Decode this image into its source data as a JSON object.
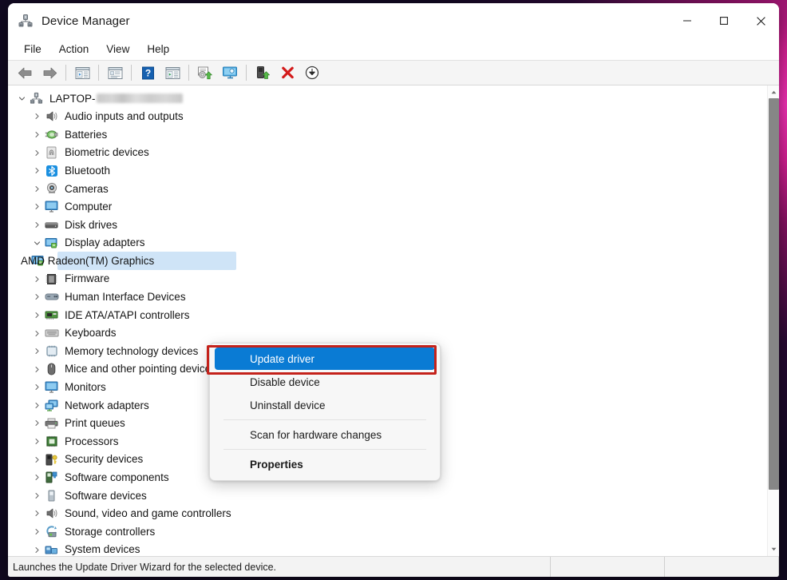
{
  "window": {
    "title": "Device Manager",
    "icon": "device-manager-icon",
    "controls": {
      "minimize": "minimize-icon",
      "maximize": "maximize-icon",
      "close": "close-icon"
    }
  },
  "menubar": {
    "items": [
      {
        "label": "File"
      },
      {
        "label": "Action"
      },
      {
        "label": "View"
      },
      {
        "label": "Help"
      }
    ]
  },
  "toolbar": {
    "buttons": [
      {
        "name": "back-icon"
      },
      {
        "name": "forward-icon"
      },
      {
        "name": "separator"
      },
      {
        "name": "show-hide-console-tree-icon"
      },
      {
        "name": "separator"
      },
      {
        "name": "properties-icon"
      },
      {
        "name": "separator"
      },
      {
        "name": "help-icon"
      },
      {
        "name": "show-details-icon"
      },
      {
        "name": "separator"
      },
      {
        "name": "update-driver-icon"
      },
      {
        "name": "scan-hardware-changes-icon"
      },
      {
        "name": "separator"
      },
      {
        "name": "enable-device-icon"
      },
      {
        "name": "uninstall-device-icon"
      },
      {
        "name": "install-legacy-device-icon"
      }
    ]
  },
  "tree": {
    "root": {
      "label": "LAPTOP-",
      "redacted": true,
      "expanded": true,
      "icon": "computer-node-icon"
    },
    "items": [
      {
        "label": "Audio inputs and outputs",
        "icon": "speaker-icon",
        "expanded": false,
        "level": "child"
      },
      {
        "label": "Batteries",
        "icon": "battery-icon",
        "expanded": false,
        "level": "child"
      },
      {
        "label": "Biometric devices",
        "icon": "fingerprint-icon",
        "expanded": false,
        "level": "child"
      },
      {
        "label": "Bluetooth",
        "icon": "bluetooth-icon",
        "expanded": false,
        "level": "child"
      },
      {
        "label": "Cameras",
        "icon": "camera-icon",
        "expanded": false,
        "level": "child"
      },
      {
        "label": "Computer",
        "icon": "monitor-icon",
        "expanded": false,
        "level": "child"
      },
      {
        "label": "Disk drives",
        "icon": "disk-drive-icon",
        "expanded": false,
        "level": "child"
      },
      {
        "label": "Display adapters",
        "icon": "display-adapter-icon",
        "expanded": true,
        "level": "child"
      },
      {
        "label": "AMD Radeon(TM) Graphics",
        "icon": "display-adapter-icon",
        "selected": true,
        "level": "leaf"
      },
      {
        "label": "Firmware",
        "icon": "firmware-icon",
        "expanded": false,
        "level": "child"
      },
      {
        "label": "Human Interface Devices",
        "icon": "hid-icon",
        "expanded": false,
        "level": "child"
      },
      {
        "label": "IDE ATA/ATAPI controllers",
        "icon": "ide-controller-icon",
        "expanded": false,
        "level": "child"
      },
      {
        "label": "Keyboards",
        "icon": "keyboard-icon",
        "expanded": false,
        "level": "child"
      },
      {
        "label": "Memory technology devices",
        "icon": "memory-icon",
        "expanded": false,
        "level": "child"
      },
      {
        "label": "Mice and other pointing devices",
        "icon": "mouse-icon",
        "expanded": false,
        "level": "child"
      },
      {
        "label": "Monitors",
        "icon": "monitor-icon",
        "expanded": false,
        "level": "child"
      },
      {
        "label": "Network adapters",
        "icon": "network-adapter-icon",
        "expanded": false,
        "level": "child"
      },
      {
        "label": "Print queues",
        "icon": "printer-icon",
        "expanded": false,
        "level": "child"
      },
      {
        "label": "Processors",
        "icon": "processor-icon",
        "expanded": false,
        "level": "child"
      },
      {
        "label": "Security devices",
        "icon": "security-device-icon",
        "expanded": false,
        "level": "child"
      },
      {
        "label": "Software components",
        "icon": "software-component-icon",
        "expanded": false,
        "level": "child"
      },
      {
        "label": "Software devices",
        "icon": "software-device-icon",
        "expanded": false,
        "level": "child"
      },
      {
        "label": "Sound, video and game controllers",
        "icon": "speaker-icon",
        "expanded": false,
        "level": "child"
      },
      {
        "label": "Storage controllers",
        "icon": "storage-controller-icon",
        "expanded": false,
        "level": "child"
      },
      {
        "label": "System devices",
        "icon": "system-device-icon",
        "expanded": false,
        "level": "child"
      }
    ]
  },
  "context_menu": {
    "items": [
      {
        "label": "Update driver",
        "highlighted": true,
        "bold": false
      },
      {
        "label": "Disable device",
        "highlighted": false,
        "bold": false
      },
      {
        "label": "Uninstall device",
        "highlighted": false,
        "bold": false
      },
      {
        "separator": true
      },
      {
        "label": "Scan for hardware changes",
        "highlighted": false,
        "bold": false
      },
      {
        "separator": true
      },
      {
        "label": "Properties",
        "highlighted": false,
        "bold": true
      }
    ],
    "highlight_color": "#0a7bd4",
    "annotation_border_color": "#c4221b"
  },
  "statusbar": {
    "message": "Launches the Update Driver Wizard for the selected device."
  }
}
